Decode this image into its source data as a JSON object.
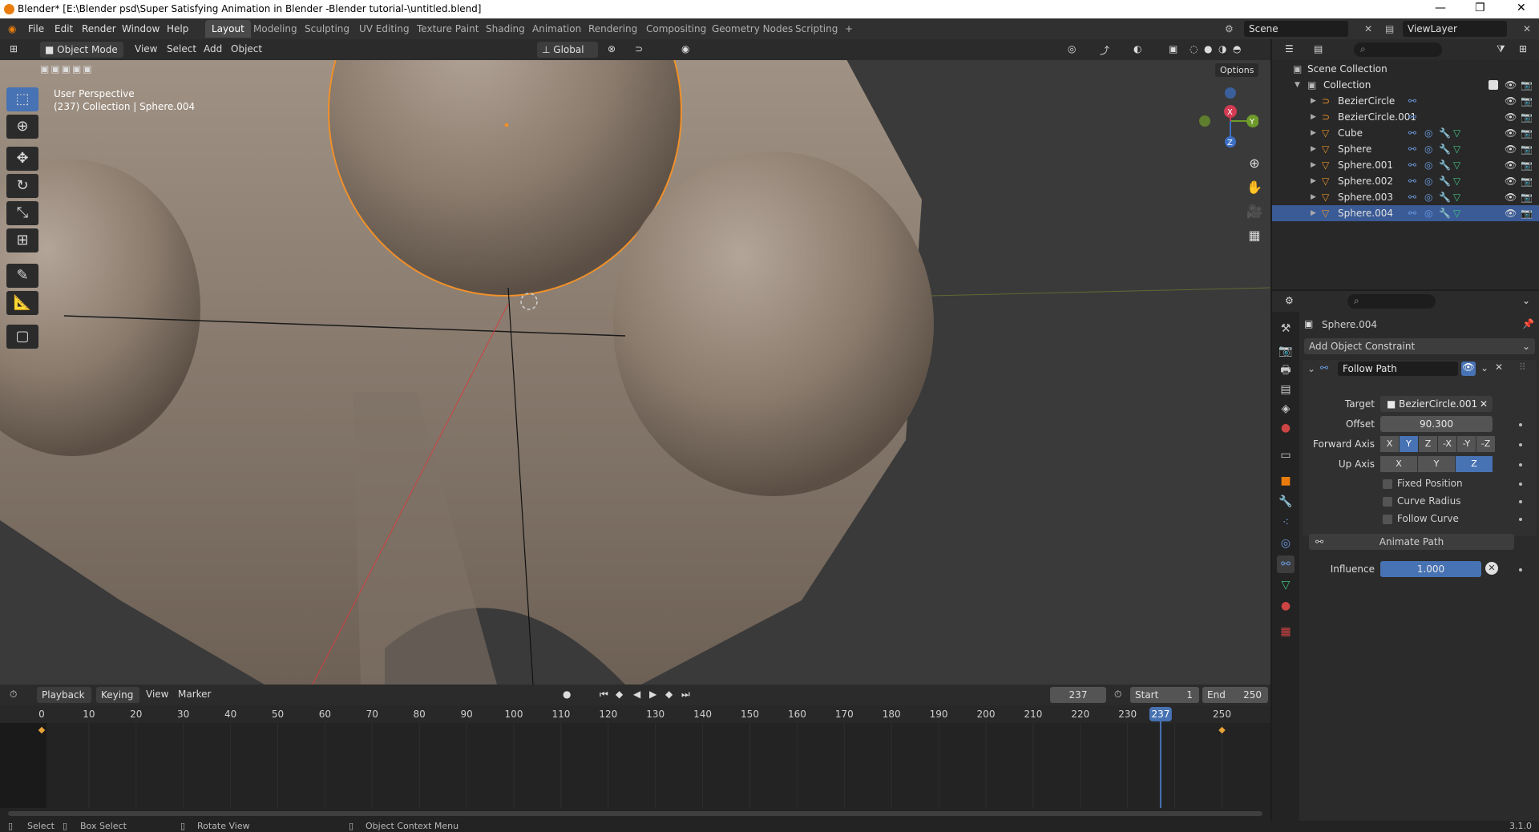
{
  "window": {
    "title": "Blender* [E:\\Blender  psd\\Super Satisfying  Animation in Blender -Blender tutorial-\\untitled.blend]",
    "controls": [
      "—",
      "❐",
      "✕"
    ]
  },
  "menubar": {
    "menus": [
      "File",
      "Edit",
      "Render",
      "Window",
      "Help"
    ],
    "workspaces": [
      "Layout",
      "Modeling",
      "Sculpting",
      "UV Editing",
      "Texture Paint",
      "Shading",
      "Animation",
      "Rendering",
      "Compositing",
      "Geometry Nodes",
      "Scripting"
    ],
    "active_workspace": "Layout",
    "add_tab": "+",
    "scene": "Scene",
    "view_layer": "ViewLayer"
  },
  "viewport": {
    "mode": "Object Mode",
    "menus": [
      "View",
      "Select",
      "Add",
      "Object"
    ],
    "orientation": "Global",
    "options_label": "Options",
    "overlay_title": "User Perspective",
    "overlay_subtitle": "(237) Collection | Sphere.004",
    "gizmo_axes": {
      "x": "X",
      "y": "Y",
      "z": "Z"
    },
    "tools": [
      "select-box-tool",
      "cursor-tool",
      "move-tool",
      "rotate-tool",
      "scale-tool",
      "transform-tool",
      "annotate-tool",
      "measure-tool",
      "add-cube-tool"
    ]
  },
  "timeline": {
    "menus": [
      "Playback",
      "Keying",
      "View",
      "Marker"
    ],
    "current_frame": "237",
    "start_label": "Start",
    "start": "1",
    "end_label": "End",
    "end": "250",
    "ticks": [
      "0",
      "10",
      "20",
      "30",
      "40",
      "50",
      "60",
      "70",
      "80",
      "90",
      "100",
      "110",
      "120",
      "130",
      "140",
      "150",
      "160",
      "170",
      "180",
      "190",
      "200",
      "210",
      "220",
      "230",
      "237",
      "250"
    ],
    "playhead_label": "237",
    "keyframes": [
      0,
      250
    ]
  },
  "outliner": {
    "root": "Scene Collection",
    "collection": "Collection",
    "items": [
      {
        "name": "BezierCircle",
        "type": "curve"
      },
      {
        "name": "BezierCircle.001",
        "type": "curve"
      },
      {
        "name": "Cube",
        "type": "mesh"
      },
      {
        "name": "Sphere",
        "type": "mesh"
      },
      {
        "name": "Sphere.001",
        "type": "mesh"
      },
      {
        "name": "Sphere.002",
        "type": "mesh"
      },
      {
        "name": "Sphere.003",
        "type": "mesh"
      },
      {
        "name": "Sphere.004",
        "type": "mesh",
        "selected": true
      }
    ]
  },
  "properties": {
    "object_name": "Sphere.004",
    "add_constraint": "Add Object Constraint",
    "constraint_name": "Follow Path",
    "target_label": "Target",
    "target_value": "BezierCircle.001",
    "offset_label": "Offset",
    "offset_value": "90.300",
    "forward_axis_label": "Forward Axis",
    "forward_axis_options": [
      "X",
      "Y",
      "Z",
      "-X",
      "-Y",
      "-Z"
    ],
    "forward_axis_selected": "Y",
    "up_axis_label": "Up Axis",
    "up_axis_options": [
      "X",
      "Y",
      "Z"
    ],
    "up_axis_selected": "Z",
    "checkboxes": [
      "Fixed Position",
      "Curve Radius",
      "Follow Curve"
    ],
    "animate_path": "Animate Path",
    "influence_label": "Influence",
    "influence_value": "1.000"
  },
  "statusbar": {
    "select": "Select",
    "box_select": "Box Select",
    "rotate_view": "Rotate View",
    "context_menu": "Object Context Menu",
    "version": "3.1.0"
  },
  "colors": {
    "accent": "#4772b3",
    "selection_outline": "#f0902a",
    "background": "#303030"
  }
}
